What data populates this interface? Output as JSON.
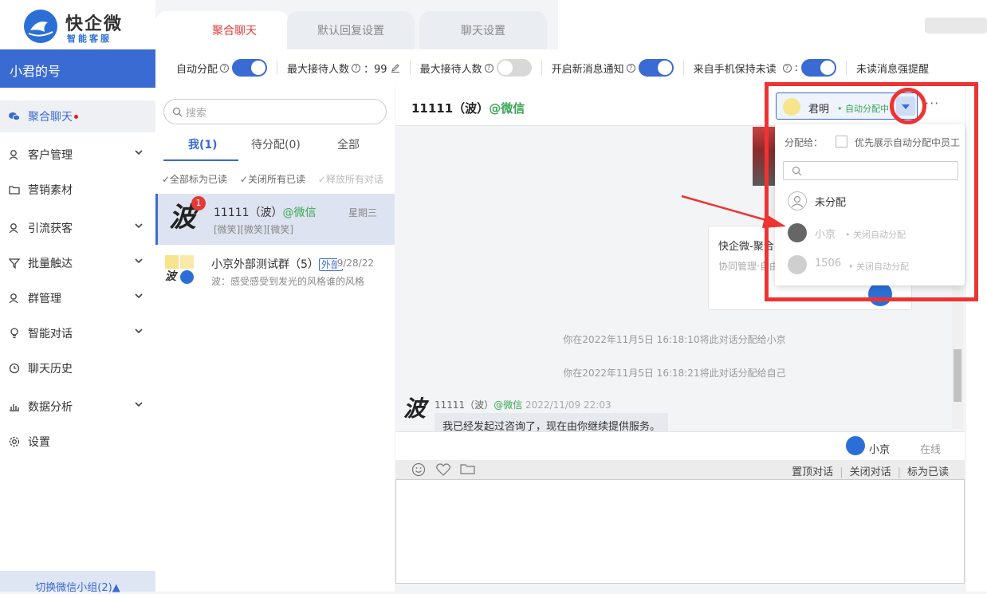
{
  "brand": {
    "name": "快企微",
    "subtitle": "智能客服"
  },
  "account": {
    "name": "小君的号"
  },
  "top_tabs": [
    "聚合聊天",
    "默认回复设置",
    "聊天设置"
  ],
  "toolbar": {
    "auto_assign": "自动分配",
    "max_receivers": "最大接待人数",
    "max_receivers_value": "：99",
    "max_receivers_2": "最大接待人数",
    "new_msg_notify": "开启新消息通知",
    "keep_unread": "来自手机保持未读",
    "unread_reminder": "未读消息强提醒"
  },
  "sidebar": {
    "items": [
      {
        "label": "聚合聊天",
        "icon": "wechat-icon",
        "active": true
      },
      {
        "label": "客户管理",
        "icon": "customer-icon"
      },
      {
        "label": "营销素材",
        "icon": "folder-icon"
      },
      {
        "label": "引流获客",
        "icon": "user-icon"
      },
      {
        "label": "批量触达",
        "icon": "funnel-icon"
      },
      {
        "label": "群管理",
        "icon": "group-icon"
      },
      {
        "label": "智能对话",
        "icon": "bulb-icon"
      },
      {
        "label": "聊天历史",
        "icon": "clock-icon"
      },
      {
        "label": "数据分析",
        "icon": "chart-icon"
      },
      {
        "label": "设置",
        "icon": "gear-icon"
      }
    ],
    "switch_group": "切换微信小组(2)▲"
  },
  "conversations": {
    "search_placeholder": "搜索",
    "tabs": [
      "我(1)",
      "待分配(0)",
      "全部"
    ],
    "bulk_actions": [
      "✓全部标为已读",
      "✓关闭所有已读",
      "✓释放所有对话"
    ],
    "items": [
      {
        "name": "11111（波）",
        "source": "@微信",
        "preview": "[微笑][微笑][微笑]",
        "time": "星期三",
        "badge": "1",
        "avatar_char": "波"
      },
      {
        "name": "小京外部测试群（5）",
        "tag": "外部",
        "time": "9/28/22",
        "preview": "波：感受感受到发光的风格谁的风格"
      }
    ]
  },
  "chat": {
    "title": "11111（波）",
    "source": "@微信",
    "assignee": "君明",
    "assignee_status": "• 自动分配中",
    "more": "···",
    "card_title": "快企微-聚合",
    "card_desc": "协同管理·自由接",
    "system_messages": [
      "你在2022年11月5日 16:18:10将此对话分配给小京",
      "你在2022年11月5日 16:18:21将此对话分配给自己"
    ],
    "message": {
      "sender": "11111（波）",
      "source": "@微信",
      "time": "2022/11/09 22:03",
      "text": "我已经发起过咨询了，现在由你继续提供服务。"
    },
    "agent_name": "小京",
    "agent_status": "在线",
    "input_actions": [
      "置顶对话",
      "关闭对话",
      "标为已读"
    ]
  },
  "assign_dropdown": {
    "label": "分配给：",
    "checkbox_label": "优先展示自动分配中员工",
    "options": [
      {
        "name": "未分配",
        "status": ""
      },
      {
        "name": "小京",
        "status": "• 关闭自动分配"
      },
      {
        "name": "1506",
        "status": "• 关闭自动分配"
      }
    ]
  },
  "colors": {
    "primary": "#3a6bd3",
    "danger": "#ee3333",
    "success": "#3aa655"
  }
}
